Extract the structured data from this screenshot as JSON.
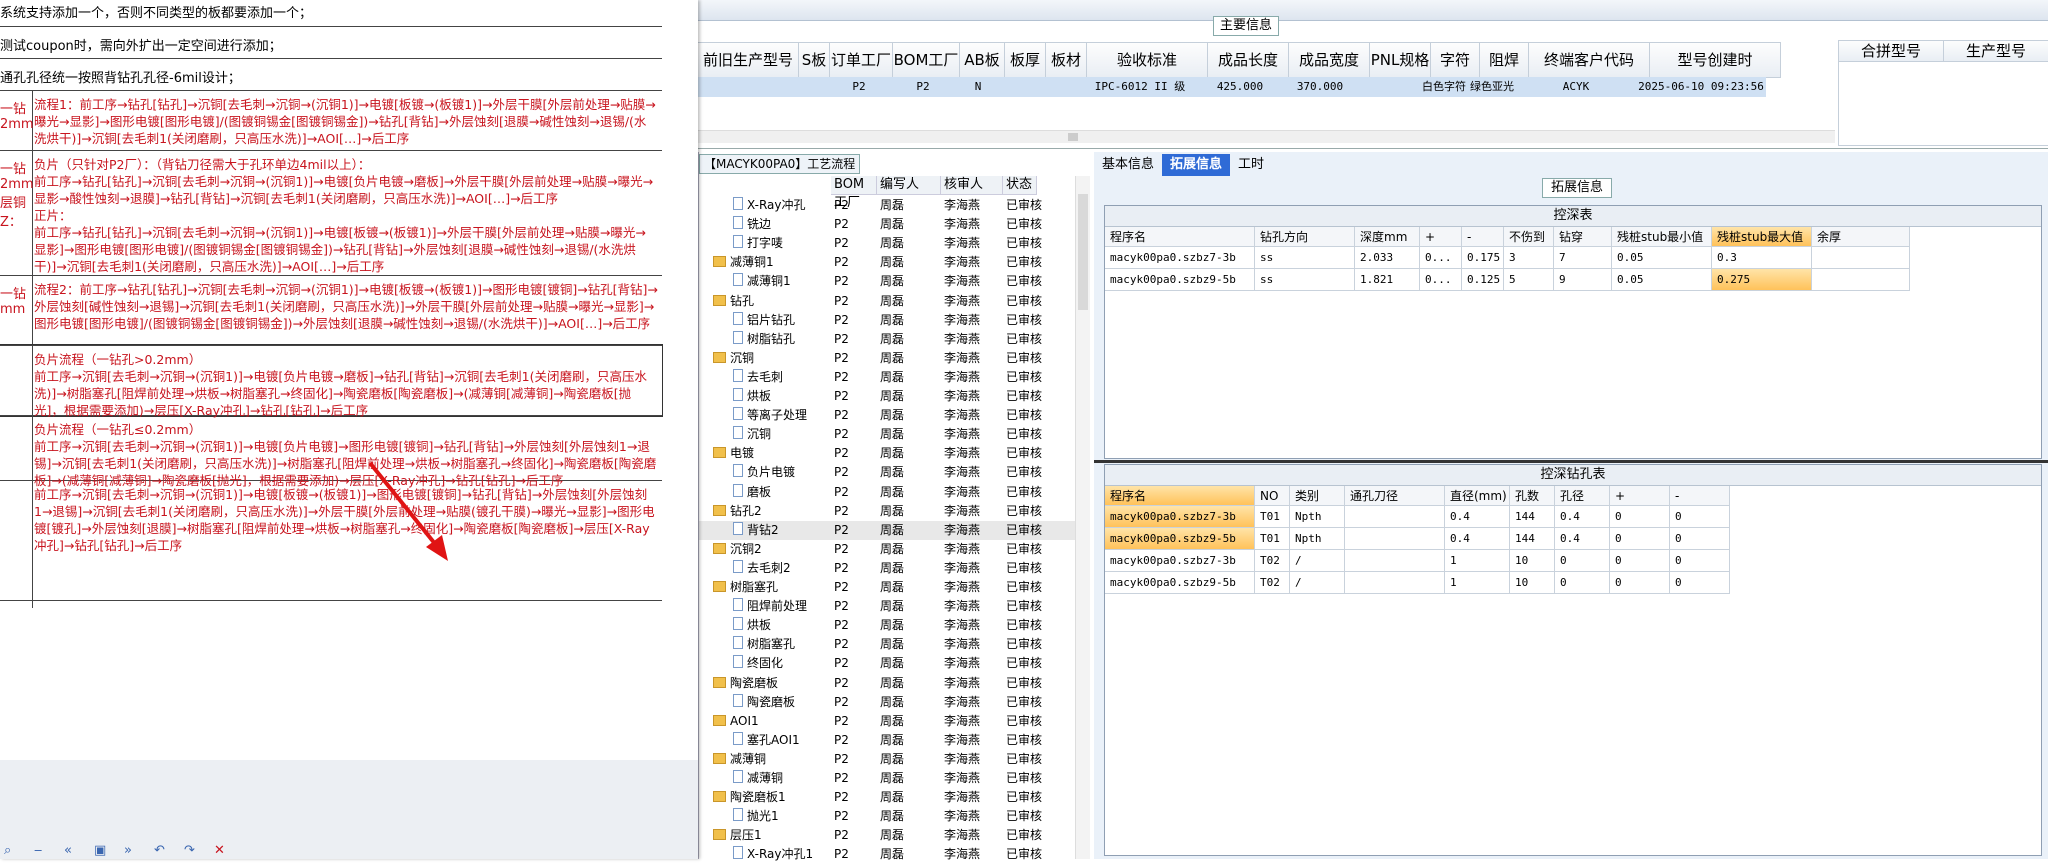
{
  "main_info": {
    "title": "主要信息",
    "headers": [
      "前旧生产型号",
      "S板",
      "订单工厂",
      "BOM工厂",
      "AB板",
      "板厚",
      "板材",
      "验收标准",
      "成品长度",
      "成品宽度",
      "PNL规格",
      "字符",
      "阻焊",
      "终端客户代码",
      "型号创建时"
    ],
    "row": [
      "",
      "",
      "P2",
      "P2",
      "N",
      "",
      "",
      "IPC-6012 II 级",
      "425.000",
      "370.000",
      "",
      "白色字符",
      "绿色亚光",
      "ACYK",
      "2025-06-10 09:23:56"
    ],
    "side_headers": [
      "合拼型号",
      "生产型号"
    ]
  },
  "doc": {
    "line1": "系统支持添加一个，否则不同类型的板都要添加一个；",
    "line2": "测试coupon时，需向外扩出一定空间进行添加；",
    "line3": "通孔孔径统一按照背钻孔孔径-6mil设计；",
    "rows": [
      {
        "label": "一钻\n2mm",
        "text": "流程1：前工序→钻孔[钻孔]→沉铜[去毛刺→沉铜→(沉铜1)]→电镀[板镀→(板镀1)]→外层干膜[外层前处理→贴膜→曝光→显影]→图形电镀[图形电镀]/(图镀铜锡金[图镀铜锡金])→钻孔[背钻]→外层蚀刻[退膜→碱性蚀刻→退锡/(水洗烘干)]→沉铜[去毛刺1(关闭磨刷，只高压水洗)]→AOI[…]→后工序"
      },
      {
        "label": "一钻\n2mm\n层铜\nZ：",
        "text": "负片（只针对P2厂）：（背钻刀径需大于孔环单边4mil以上）：\n前工序→钻孔[钻孔]→沉铜[去毛刺→沉铜→(沉铜1)]→电镀[负片电镀→磨板]→外层干膜[外层前处理→贴膜→曝光→显影→酸性蚀刻→退膜]→钻孔[背钻]→沉铜[去毛刺1(关闭磨刷，只高压水洗)]→AOI[…]→后工序\n\n正片：\n前工序→钻孔[钻孔]→沉铜[去毛刺→沉铜→(沉铜1)]→电镀[板镀→(板镀1)]→外层干膜[外层前处理→贴膜→曝光→显影]→图形电镀[图形电镀]/(图镀铜锡金[图镀铜锡金])→钻孔[背钻]→外层蚀刻[退膜→碱性蚀刻→退锡/(水洗烘干)]→沉铜[去毛刺1(关闭磨刷，只高压水洗)]→AOI[…]→后工序"
      },
      {
        "label": "一钻\nmm",
        "text": "流程2：前工序→钻孔[钻孔]→沉铜[去毛刺→沉铜→(沉铜1)]→电镀[板镀→(板镀1)]→图形电镀[镀铜]→钻孔[背钻]→外层蚀刻[碱性蚀刻→退锡]→沉铜[去毛刺1(关闭磨刷，只高压水洗)]→外层干膜[外层前处理→贴膜→曝光→显影]→图形电镀[图形电镀]/(图镀铜锡金[图镀铜锡金])→外层蚀刻[退膜→碱性蚀刻→退锡/(水洗烘干)]→AOI[…]→后工序"
      },
      {
        "label": "",
        "text": "负片流程（一钻孔>0.2mm）\n前工序→沉铜[去毛刺→沉铜→(沉铜1)]→电镀[负片电镀→磨板]→钻孔[背钻]→沉铜[去毛刺1(关闭磨刷，只高压水洗)]→树脂塞孔[阻焊前处理→烘板→树脂塞孔→终固化]→陶瓷磨板[陶瓷磨板]→(减薄铜[减薄铜]→陶瓷磨板[抛光]，根据需要添加)→层压[X-Ray冲孔]→钻孔[钻孔]→后工序"
      },
      {
        "label": "",
        "text": "负片流程（一钻孔≤0.2mm）\n前工序→沉铜[去毛刺→沉铜→(沉铜1)]→电镀[负片电镀]→图形电镀[镀铜]→钻孔[背钻]→外层蚀刻[外层蚀刻1→退锡]→沉铜[去毛刺1(关闭磨刷，只高压水洗)]→树脂塞孔[阻焊前处理→烘板→树脂塞孔→终固化]→陶瓷磨板[陶瓷磨板]→(减薄铜[减薄铜]→陶瓷磨板[抛光]，根据需要添加)→层压[X-Ray冲孔]→钻孔[钻孔]→后工序"
      },
      {
        "label": "",
        "text": "前工序→沉铜[去毛刺→沉铜→(沉铜1)]→电镀[板镀→(板镀1)]→图形电镀[镀铜]→钻孔[背钻]→外层蚀刻[外层蚀刻1→退锡]→沉铜[去毛刺1(关闭磨刷，只高压水洗)]→外层干膜[外层前处理→贴膜(镀孔干膜)→曝光→显影]→图形电镀[镀孔]→外层蚀刻[退膜]→树脂塞孔[阻焊前处理→烘板→树脂塞孔→终固化]→陶瓷磨板[陶瓷磨板]→层压[X-Ray冲孔]→钻孔[钻孔]→后工序"
      }
    ]
  },
  "tree": {
    "caption": "【MACYK00PA0】工艺流程",
    "headers": [
      "BOM工厂",
      "编写人",
      "核审人",
      "状态"
    ],
    "rows": [
      {
        "name": "X-Ray冲孔",
        "indent": 2,
        "type": "page",
        "bom": "P2",
        "writer": "周磊",
        "reviewer": "李海燕",
        "status": "已审核"
      },
      {
        "name": "铣边",
        "indent": 2,
        "type": "page",
        "bom": "P2",
        "writer": "周磊",
        "reviewer": "李海燕",
        "status": "已审核"
      },
      {
        "name": "打字唛",
        "indent": 2,
        "type": "page",
        "bom": "P2",
        "writer": "周磊",
        "reviewer": "李海燕",
        "status": "已审核"
      },
      {
        "name": "减薄铜1",
        "indent": 1,
        "type": "folder",
        "bom": "P2",
        "writer": "周磊",
        "reviewer": "李海燕",
        "status": "已审核"
      },
      {
        "name": "减薄铜1",
        "indent": 2,
        "type": "page",
        "bom": "P2",
        "writer": "周磊",
        "reviewer": "李海燕",
        "status": "已审核"
      },
      {
        "name": "钻孔",
        "indent": 1,
        "type": "folder",
        "bom": "P2",
        "writer": "周磊",
        "reviewer": "李海燕",
        "status": "已审核"
      },
      {
        "name": "铝片钻孔",
        "indent": 2,
        "type": "page",
        "bom": "P2",
        "writer": "周磊",
        "reviewer": "李海燕",
        "status": "已审核"
      },
      {
        "name": "树脂钻孔",
        "indent": 2,
        "type": "page",
        "bom": "P2",
        "writer": "周磊",
        "reviewer": "李海燕",
        "status": "已审核"
      },
      {
        "name": "沉铜",
        "indent": 1,
        "type": "folder",
        "bom": "P2",
        "writer": "周磊",
        "reviewer": "李海燕",
        "status": "已审核"
      },
      {
        "name": "去毛刺",
        "indent": 2,
        "type": "page",
        "bom": "P2",
        "writer": "周磊",
        "reviewer": "李海燕",
        "status": "已审核"
      },
      {
        "name": "烘板",
        "indent": 2,
        "type": "page",
        "bom": "P2",
        "writer": "周磊",
        "reviewer": "李海燕",
        "status": "已审核"
      },
      {
        "name": "等离子处理",
        "indent": 2,
        "type": "page",
        "bom": "P2",
        "writer": "周磊",
        "reviewer": "李海燕",
        "status": "已审核"
      },
      {
        "name": "沉铜",
        "indent": 2,
        "type": "page",
        "bom": "P2",
        "writer": "周磊",
        "reviewer": "李海燕",
        "status": "已审核"
      },
      {
        "name": "电镀",
        "indent": 1,
        "type": "folder",
        "bom": "P2",
        "writer": "周磊",
        "reviewer": "李海燕",
        "status": "已审核"
      },
      {
        "name": "负片电镀",
        "indent": 2,
        "type": "page",
        "bom": "P2",
        "writer": "周磊",
        "reviewer": "李海燕",
        "status": "已审核"
      },
      {
        "name": "磨板",
        "indent": 2,
        "type": "page",
        "bom": "P2",
        "writer": "周磊",
        "reviewer": "李海燕",
        "status": "已审核"
      },
      {
        "name": "钻孔2",
        "indent": 1,
        "type": "folder",
        "bom": "P2",
        "writer": "周磊",
        "reviewer": "李海燕",
        "status": "已审核"
      },
      {
        "name": "背钻2",
        "indent": 2,
        "type": "page",
        "bom": "P2",
        "writer": "周磊",
        "reviewer": "李海燕",
        "status": "已审核"
      },
      {
        "name": "沉铜2",
        "indent": 1,
        "type": "folder",
        "bom": "P2",
        "writer": "周磊",
        "reviewer": "李海燕",
        "status": "已审核"
      },
      {
        "name": "去毛刺2",
        "indent": 2,
        "type": "page",
        "bom": "P2",
        "writer": "周磊",
        "reviewer": "李海燕",
        "status": "已审核"
      },
      {
        "name": "树脂塞孔",
        "indent": 1,
        "type": "folder",
        "bom": "P2",
        "writer": "周磊",
        "reviewer": "李海燕",
        "status": "已审核"
      },
      {
        "name": "阻焊前处理",
        "indent": 2,
        "type": "page",
        "bom": "P2",
        "writer": "周磊",
        "reviewer": "李海燕",
        "status": "已审核"
      },
      {
        "name": "烘板",
        "indent": 2,
        "type": "page",
        "bom": "P2",
        "writer": "周磊",
        "reviewer": "李海燕",
        "status": "已审核"
      },
      {
        "name": "树脂塞孔",
        "indent": 2,
        "type": "page",
        "bom": "P2",
        "writer": "周磊",
        "reviewer": "李海燕",
        "status": "已审核"
      },
      {
        "name": "终固化",
        "indent": 2,
        "type": "page",
        "bom": "P2",
        "writer": "周磊",
        "reviewer": "李海燕",
        "status": "已审核"
      },
      {
        "name": "陶瓷磨板",
        "indent": 1,
        "type": "folder",
        "bom": "P2",
        "writer": "周磊",
        "reviewer": "李海燕",
        "status": "已审核"
      },
      {
        "name": "陶瓷磨板",
        "indent": 2,
        "type": "page",
        "bom": "P2",
        "writer": "周磊",
        "reviewer": "李海燕",
        "status": "已审核"
      },
      {
        "name": "AOI1",
        "indent": 1,
        "type": "folder",
        "bom": "P2",
        "writer": "周磊",
        "reviewer": "李海燕",
        "status": "已审核"
      },
      {
        "name": "塞孔AOI1",
        "indent": 2,
        "type": "page",
        "bom": "P2",
        "writer": "周磊",
        "reviewer": "李海燕",
        "status": "已审核"
      },
      {
        "name": "减薄铜",
        "indent": 1,
        "type": "folder",
        "bom": "P2",
        "writer": "周磊",
        "reviewer": "李海燕",
        "status": "已审核"
      },
      {
        "name": "减薄铜",
        "indent": 2,
        "type": "page",
        "bom": "P2",
        "writer": "周磊",
        "reviewer": "李海燕",
        "status": "已审核"
      },
      {
        "name": "陶瓷磨板1",
        "indent": 1,
        "type": "folder",
        "bom": "P2",
        "writer": "周磊",
        "reviewer": "李海燕",
        "status": "已审核"
      },
      {
        "name": "抛光1",
        "indent": 2,
        "type": "page",
        "bom": "P2",
        "writer": "周磊",
        "reviewer": "李海燕",
        "status": "已审核"
      },
      {
        "name": "层压1",
        "indent": 1,
        "type": "folder",
        "bom": "P2",
        "writer": "周磊",
        "reviewer": "李海燕",
        "status": "已审核"
      },
      {
        "name": "X-Ray冲孔1",
        "indent": 2,
        "type": "page",
        "bom": "P2",
        "writer": "周磊",
        "reviewer": "李海燕",
        "status": "已审核"
      }
    ]
  },
  "tabs": [
    "基本信息",
    "拓展信息",
    "工时"
  ],
  "active_tab": 1,
  "ext": {
    "caption": "拓展信息",
    "depth": {
      "title": "控深表",
      "headers": [
        "程序名",
        "钻孔方向",
        "深度mm",
        "+",
        "-",
        "不伤到",
        "钻穿",
        "残桩stub最小值",
        "残桩stub最大值",
        "余厚"
      ],
      "rows": [
        [
          "macyk00pa0.szbz7-3b",
          "ss",
          "2.033",
          "0...",
          "0.175",
          "3",
          "7",
          "0.05",
          "0.3",
          ""
        ],
        [
          "macyk00pa0.szbz9-5b",
          "ss",
          "1.821",
          "0...",
          "0.125",
          "5",
          "9",
          "0.05",
          "0.275",
          ""
        ]
      ]
    },
    "holes": {
      "title": "控深钻孔表",
      "headers": [
        "程序名",
        "NO",
        "类别",
        "通孔刀径",
        "直径(mm)",
        "孔数",
        "孔径",
        "+",
        "-"
      ],
      "rows": [
        [
          "macyk00pa0.szbz7-3b",
          "T01",
          "Npth",
          "",
          "0.4",
          "144",
          "0.4",
          "0",
          "0"
        ],
        [
          "macyk00pa0.szbz9-5b",
          "T01",
          "Npth",
          "",
          "0.4",
          "144",
          "0.4",
          "0",
          "0"
        ],
        [
          "macyk00pa0.szbz7-3b",
          "T02",
          "/",
          "",
          "1",
          "10",
          "0",
          "0",
          "0"
        ],
        [
          "macyk00pa0.szbz9-5b",
          "T02",
          "/",
          "",
          "1",
          "10",
          "0",
          "0",
          "0"
        ]
      ]
    }
  },
  "colors": {
    "accent": "#2f6bd6",
    "doc_text": "#c8141e",
    "highlight": "#ffc25a",
    "row_select": "#cfe0f3"
  }
}
